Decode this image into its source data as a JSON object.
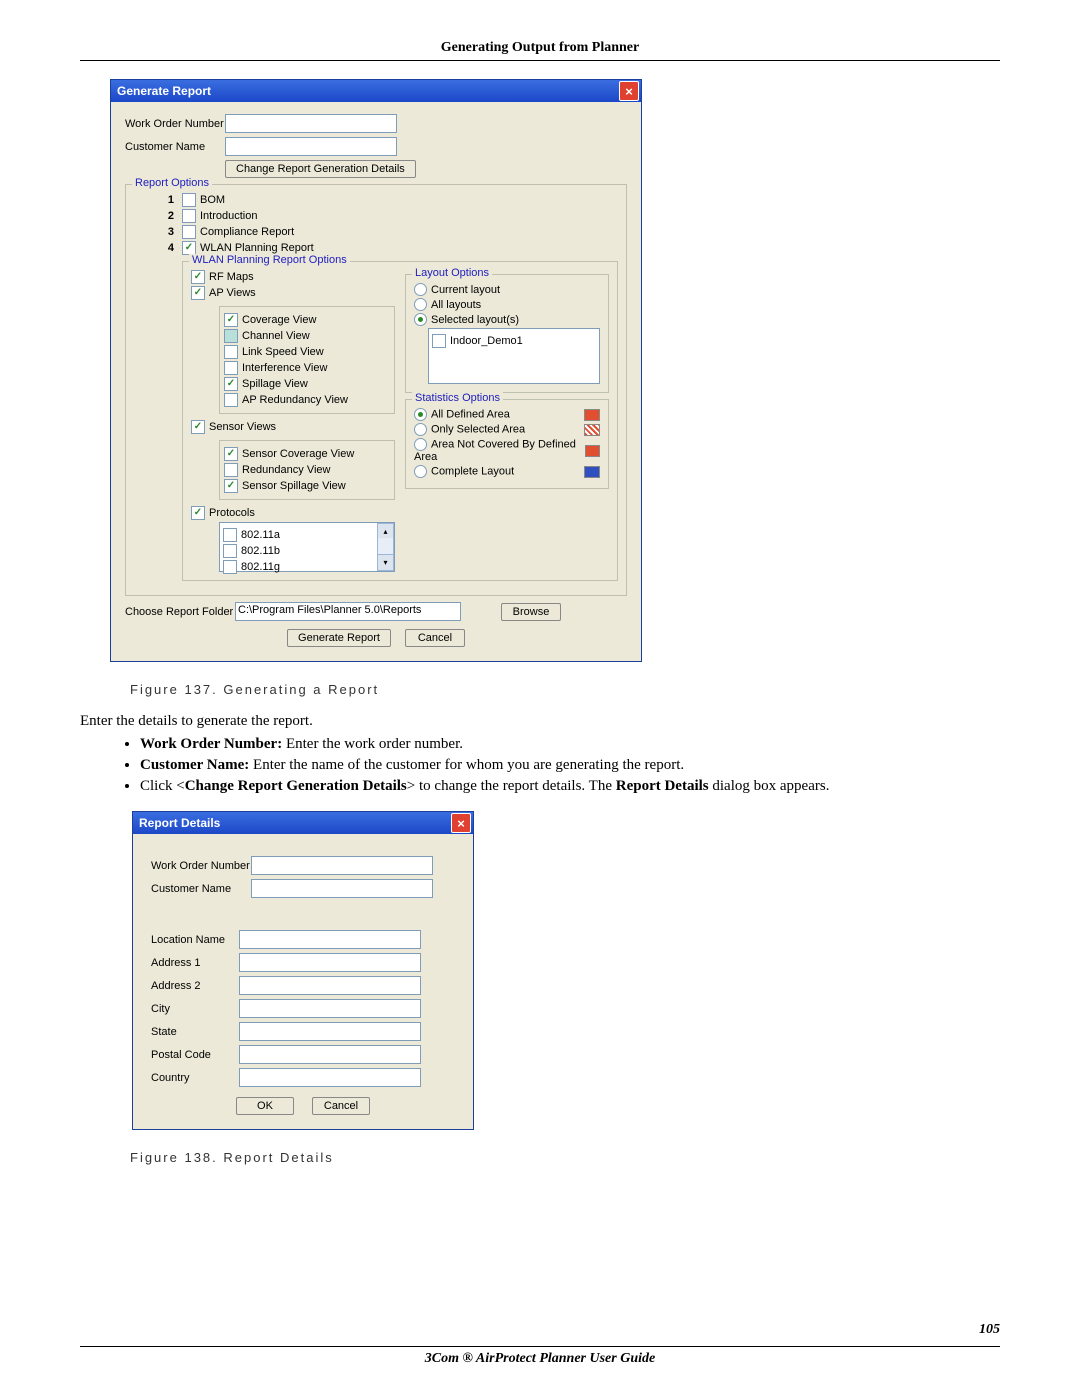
{
  "header": {
    "title": "Generating Output from Planner"
  },
  "footer": {
    "pageNum": "105",
    "title": "3Com ® AirProtect Planner User Guide"
  },
  "fig137": {
    "caption": "Figure 137.     Generating a Report"
  },
  "fig138": {
    "caption": "Figure 138.     Report Details"
  },
  "intro": "Enter the details to generate the report.",
  "bullets": {
    "b1_label": "Work Order Number:",
    "b1_text": " Enter the work order number.",
    "b2_label": "Customer Name:",
    "b2_text": " Enter the name of the customer for whom you are generating the report.",
    "b3_pre": "Click <",
    "b3_bold1": "Change Report Generation Details",
    "b3_mid": "> to change the report details. The ",
    "b3_bold2": "Report Details",
    "b3_post": " dialog box appears."
  },
  "win1": {
    "title": "Generate Report",
    "workOrderLabel": "Work Order Number",
    "customerLabel": "Customer Name",
    "changeBtn": "Change Report Generation Details",
    "reportOptions": "Report Options",
    "n1": "1",
    "n2": "2",
    "n3": "3",
    "n4": "4",
    "bom": "BOM",
    "intro": "Introduction",
    "compliance": "Compliance Report",
    "wlan": "WLAN Planning Report",
    "wlanOpts": "WLAN Planning Report Options",
    "rfmaps": "RF Maps",
    "apviews": "AP Views",
    "coverage": "Coverage View",
    "channel": "Channel View",
    "linkspeed": "Link Speed View",
    "interference": "Interference View",
    "spillage": "Spillage View",
    "apredun": "AP Redundancy View",
    "sensorviews": "Sensor Views",
    "sensorcov": "Sensor Coverage View",
    "redundancy": "Redundancy View",
    "sensorspill": "Sensor Spillage View",
    "protocols": "Protocols",
    "p1": "802.11a",
    "p2": "802.11b",
    "p3": "802.11g",
    "layoutOpts": "Layout Options",
    "curLayout": "Current layout",
    "allLayouts": "All layouts",
    "selLayouts": "Selected layout(s)",
    "demoLayout": "Indoor_Demo1",
    "statOpts": "Statistics Options",
    "allDef": "All Defined Area",
    "onlySel": "Only Selected Area",
    "notCov": "Area Not Covered By Defined Area",
    "complete": "Complete Layout",
    "folderLabel": "Choose Report Folder",
    "folderPath": "C:\\Program Files\\Planner 5.0\\Reports",
    "browse": "Browse",
    "generate": "Generate Report",
    "cancel": "Cancel"
  },
  "win2": {
    "title": "Report Details",
    "workOrder": "Work Order Number",
    "customer": "Customer Name",
    "location": "Location Name",
    "addr1": "Address 1",
    "addr2": "Address 2",
    "city": "City",
    "state": "State",
    "postal": "Postal Code",
    "country": "Country",
    "ok": "OK",
    "cancel": "Cancel"
  }
}
